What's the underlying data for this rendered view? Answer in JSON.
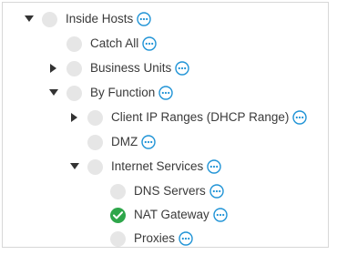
{
  "tree": {
    "items": [
      {
        "label": "Inside Hosts",
        "state": "expanded"
      },
      {
        "label": "Catch All",
        "state": "leaf"
      },
      {
        "label": "Business Units",
        "state": "collapsed"
      },
      {
        "label": "By Function",
        "state": "expanded"
      },
      {
        "label": "Client IP Ranges (DHCP Range)",
        "state": "collapsed"
      },
      {
        "label": "DMZ",
        "state": "leaf"
      },
      {
        "label": "Internet Services",
        "state": "expanded"
      },
      {
        "label": "DNS Servers",
        "state": "leaf"
      },
      {
        "label": "NAT Gateway",
        "state": "leaf",
        "selected": true
      },
      {
        "label": "Proxies",
        "state": "leaf"
      }
    ]
  },
  "colors": {
    "more_icon": "#1f93d6",
    "selected_check": "#2ea64a",
    "node_dot": "#e6e6e6",
    "caret": "#333333"
  },
  "icons": {
    "expanded": "caret-down-icon",
    "collapsed": "caret-right-icon",
    "more": "ellipsis-circle-icon",
    "selected": "check-circle-icon",
    "node": "node-dot-icon"
  }
}
